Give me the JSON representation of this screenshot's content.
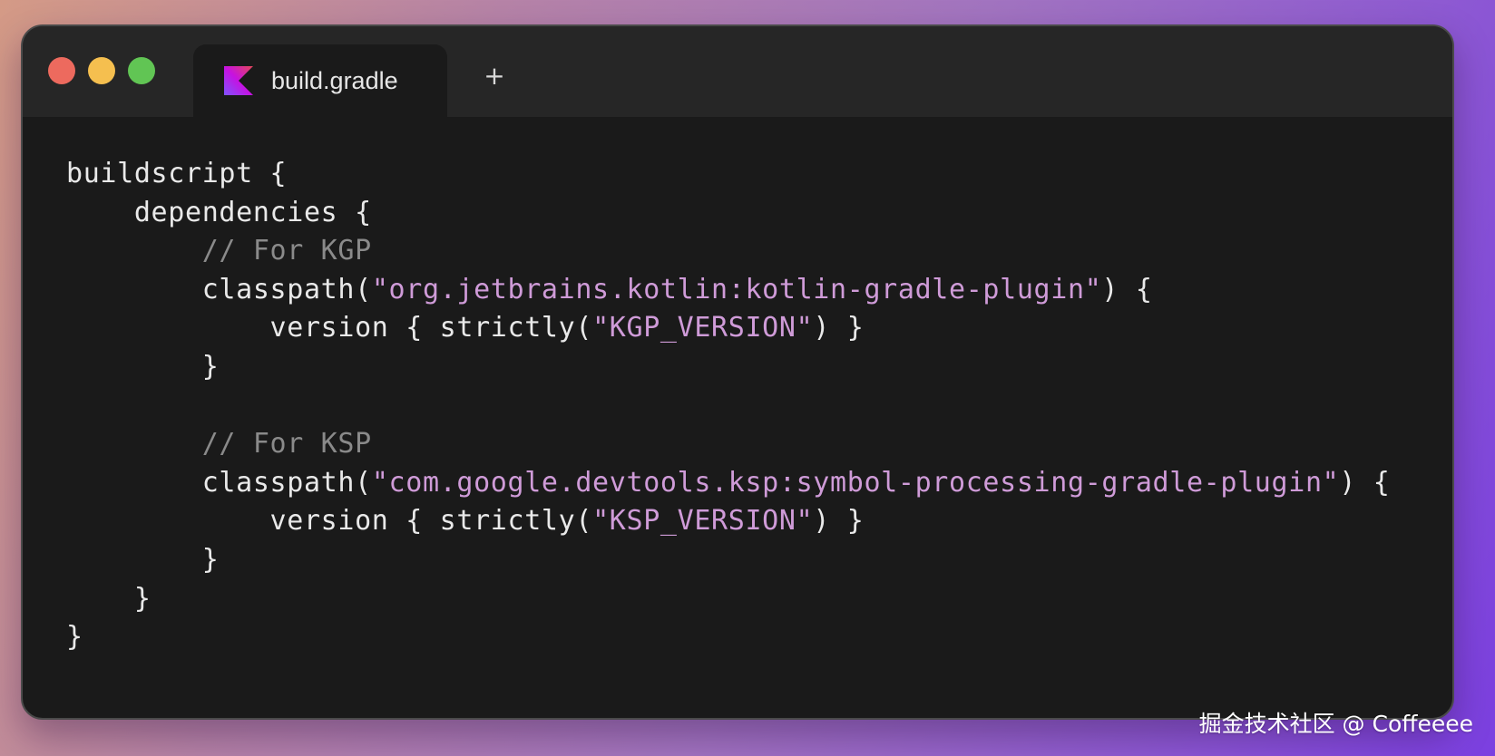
{
  "window": {
    "traffic_lights": {
      "close_color": "#ed6a5e",
      "minimize_color": "#f5bf4f",
      "maximize_color": "#61c554"
    },
    "tabs": [
      {
        "label": "build.gradle",
        "icon": "kotlin-logo-icon",
        "active": true
      }
    ],
    "new_tab_label": "+"
  },
  "editor": {
    "colors": {
      "background": "#1a1a1a",
      "text": "#e9e9e9",
      "comment": "#8a8a8a",
      "string": "#cf9bd8"
    },
    "lines": [
      [
        {
          "t": "plain",
          "v": "buildscript {"
        }
      ],
      [
        {
          "t": "plain",
          "v": "    dependencies {"
        }
      ],
      [
        {
          "t": "plain",
          "v": "        "
        },
        {
          "t": "comment",
          "v": "// For KGP"
        }
      ],
      [
        {
          "t": "plain",
          "v": "        classpath("
        },
        {
          "t": "string",
          "v": "\"org.jetbrains.kotlin:kotlin-gradle-plugin\""
        },
        {
          "t": "plain",
          "v": ") {"
        }
      ],
      [
        {
          "t": "plain",
          "v": "            version { strictly("
        },
        {
          "t": "string",
          "v": "\"KGP_VERSION\""
        },
        {
          "t": "plain",
          "v": ") }"
        }
      ],
      [
        {
          "t": "plain",
          "v": "        }"
        }
      ],
      [
        {
          "t": "plain",
          "v": ""
        }
      ],
      [
        {
          "t": "plain",
          "v": "        "
        },
        {
          "t": "comment",
          "v": "// For KSP"
        }
      ],
      [
        {
          "t": "plain",
          "v": "        classpath("
        },
        {
          "t": "string",
          "v": "\"com.google.devtools.ksp:symbol-processing-gradle-plugin\""
        },
        {
          "t": "plain",
          "v": ") {"
        }
      ],
      [
        {
          "t": "plain",
          "v": "            version { strictly("
        },
        {
          "t": "string",
          "v": "\"KSP_VERSION\""
        },
        {
          "t": "plain",
          "v": ") }"
        }
      ],
      [
        {
          "t": "plain",
          "v": "        }"
        }
      ],
      [
        {
          "t": "plain",
          "v": "    }"
        }
      ],
      [
        {
          "t": "plain",
          "v": "}"
        }
      ]
    ]
  },
  "watermark": "掘金技术社区 @ Coffeeee"
}
